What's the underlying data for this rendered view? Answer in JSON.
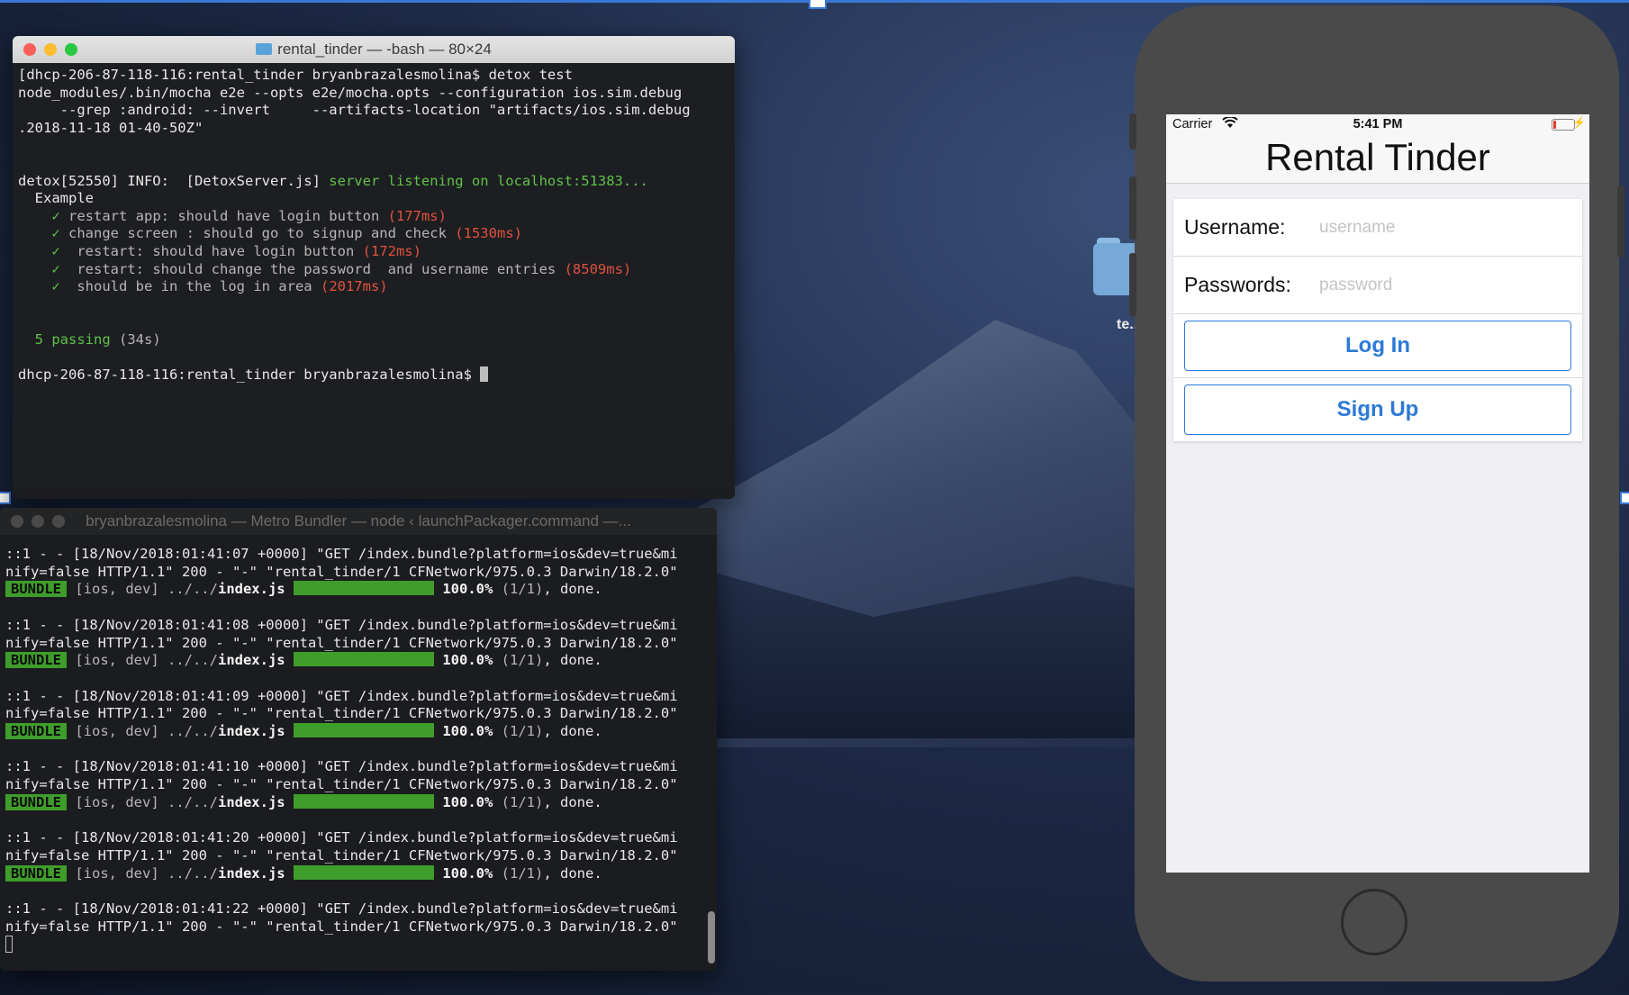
{
  "terminal1": {
    "title": "rental_tinder — -bash — 80×24",
    "lines": [
      "[dhcp-206-87-118-116:rental_tinder bryanbrazalesmolina$ detox test",
      "node_modules/.bin/mocha e2e --opts e2e/mocha.opts --configuration ios.sim.debug",
      "     --grep :android: --invert     --artifacts-location \"artifacts/ios.sim.debug",
      ".2018-11-18 01-40-50Z\"",
      "",
      "",
      "detox[52550] INFO:  [DetoxServer.js] ",
      "  Example"
    ],
    "server_msg": "server listening on localhost:51383...",
    "tests": [
      {
        "check": "✓",
        "name": "restart app: should have login button ",
        "time": "(177ms)"
      },
      {
        "check": "✓",
        "name": "change screen : should go to signup and check ",
        "time": "(1530ms)"
      },
      {
        "check": "✓",
        "name": " restart: should have login button ",
        "time": "(172ms)"
      },
      {
        "check": "✓",
        "name": " restart: should change the password  and username entries ",
        "time": "(8509ms)"
      },
      {
        "check": "✓",
        "name": " should be in the log in area ",
        "time": "(2017ms)"
      }
    ],
    "passing": "5 passing",
    "passing_time": "(34s)",
    "prompt": "dhcp-206-87-118-116:rental_tinder bryanbrazalesmolina$ "
  },
  "terminal2": {
    "title": "bryanbrazalesmolina — Metro Bundler — node ‹ launchPackager.command —...",
    "entries": [
      {
        "l1": "::1 - - [18/Nov/2018:01:41:07 +0000] \"GET /index.bundle?platform=ios&dev=true&mi",
        "l2": "nify=false HTTP/1.1\" 200 - \"-\" \"rental_tinder/1 CFNetwork/975.0.3 Darwin/18.2.0\""
      },
      {
        "l1": "::1 - - [18/Nov/2018:01:41:08 +0000] \"GET /index.bundle?platform=ios&dev=true&mi",
        "l2": "nify=false HTTP/1.1\" 200 - \"-\" \"rental_tinder/1 CFNetwork/975.0.3 Darwin/18.2.0\""
      },
      {
        "l1": "::1 - - [18/Nov/2018:01:41:09 +0000] \"GET /index.bundle?platform=ios&dev=true&mi",
        "l2": "nify=false HTTP/1.1\" 200 - \"-\" \"rental_tinder/1 CFNetwork/975.0.3 Darwin/18.2.0\""
      },
      {
        "l1": "::1 - - [18/Nov/2018:01:41:10 +0000] \"GET /index.bundle?platform=ios&dev=true&mi",
        "l2": "nify=false HTTP/1.1\" 200 - \"-\" \"rental_tinder/1 CFNetwork/975.0.3 Darwin/18.2.0\""
      },
      {
        "l1": "::1 - - [18/Nov/2018:01:41:20 +0000] \"GET /index.bundle?platform=ios&dev=true&mi",
        "l2": "nify=false HTTP/1.1\" 200 - \"-\" \"rental_tinder/1 CFNetwork/975.0.3 Darwin/18.2.0\""
      },
      {
        "l1": "::1 - - [18/Nov/2018:01:41:22 +0000] \"GET /index.bundle?platform=ios&dev=true&mi",
        "l2": "nify=false HTTP/1.1\" 200 - \"-\" \"rental_tinder/1 CFNetwork/975.0.3 Darwin/18.2.0\""
      }
    ],
    "bundle_tag": "BUNDLE",
    "bundle_target": " [ios, dev] ../../",
    "bundle_file": "index.js",
    "bundle_pct": "100.0%",
    "bundle_count": "(1/1)",
    "bundle_done": ", done.",
    "progress": 1.0
  },
  "desktop": {
    "folder_label": "te..."
  },
  "phone": {
    "carrier": "Carrier",
    "time": "5:41 PM",
    "app_title": "Rental Tinder",
    "username_label": "Username:",
    "username_placeholder": "username",
    "password_label": "Passwords:",
    "password_placeholder": "password",
    "login_label": "Log In",
    "signup_label": "Sign Up",
    "battery_level": 0.15
  },
  "colors": {
    "accent": "#2c7ad6",
    "terminal_green": "#5ec24a",
    "terminal_red": "#e0523e",
    "bundle_green": "#3f9d2b"
  }
}
